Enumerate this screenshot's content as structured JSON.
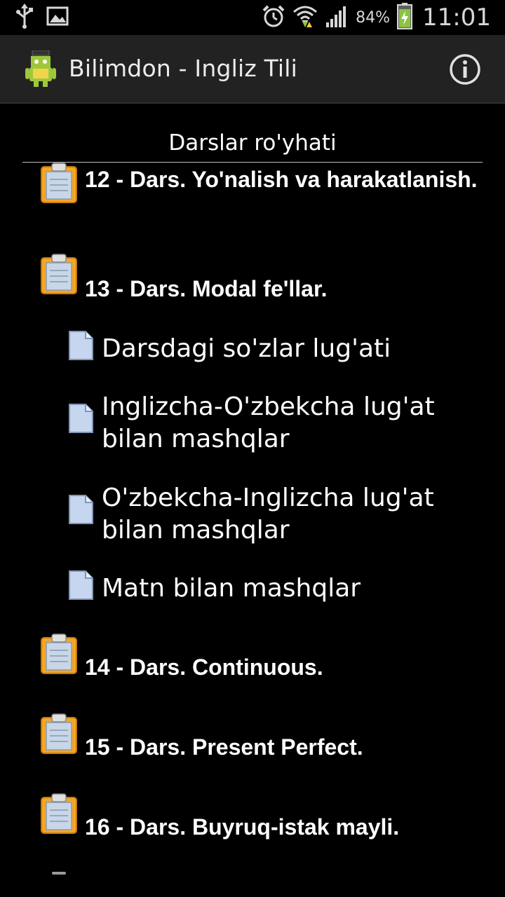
{
  "status_bar": {
    "battery_percent": "84%",
    "time": "11:01",
    "icons": [
      "usb-icon",
      "image-icon",
      "alarm-icon",
      "wifi-icon",
      "signal-icon",
      "battery-charging-icon"
    ]
  },
  "action_bar": {
    "title": "Bilimdon - Ingliz Tili",
    "icons": [
      "app-logo-icon",
      "info-icon"
    ]
  },
  "list": {
    "header": "Darslar ro'yhati",
    "items": [
      {
        "type": "group",
        "label": "12 - Dars. Yo'nalish va harakatlanish."
      },
      {
        "type": "group",
        "label": "13 - Dars. Modal fe'llar."
      },
      {
        "type": "child",
        "label": "Darsdagi so'zlar lug'ati"
      },
      {
        "type": "child",
        "label": "Inglizcha-O'zbekcha lug'at bilan mashqlar"
      },
      {
        "type": "child",
        "label": "O'zbekcha-Inglizcha lug'at bilan mashqlar"
      },
      {
        "type": "child",
        "label": "Matn bilan mashqlar"
      },
      {
        "type": "group",
        "label": "14 - Dars. Continuous."
      },
      {
        "type": "group",
        "label": "15 - Dars. Present Perfect."
      },
      {
        "type": "group",
        "label": "16 - Dars. Buyruq-istak mayli."
      }
    ]
  },
  "colors": {
    "background": "#000000",
    "action_bar": "#222222",
    "clipboard_orange": "#f5a623",
    "document_blue": "#b9cde8"
  }
}
